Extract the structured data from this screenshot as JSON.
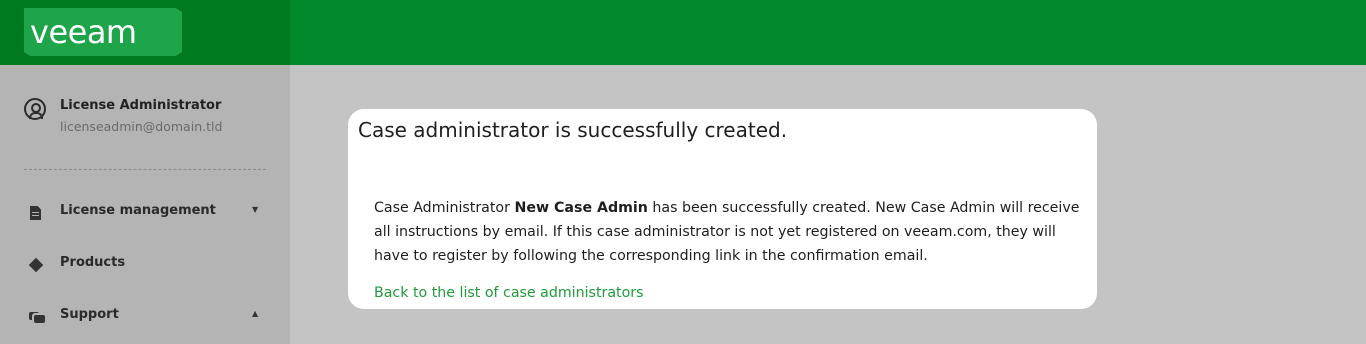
{
  "brand": {
    "logo_text": "veeam"
  },
  "user": {
    "name": "License Administrator",
    "email": "licenseadmin@domain.tld"
  },
  "nav": {
    "items": [
      {
        "label": "License management",
        "icon": "document-icon",
        "caret": "▼"
      },
      {
        "label": "Products",
        "icon": "box-icon"
      },
      {
        "label": "Support",
        "icon": "chat-icon",
        "caret": "▲"
      }
    ]
  },
  "dialog": {
    "title": "Case administrator is successfully created.",
    "body_prefix": "Case Administrator ",
    "body_bold": "New Case Admin",
    "body_suffix": " has been successfully created. New Case Admin will receive all instructions by email. If this case administrator is not yet registered on veeam.com, they will have to register by following the corresponding link in the confirmation email.",
    "back_link": "Back to the list of case administrators"
  },
  "colors": {
    "header_green": "#008a2c",
    "logo_green": "#00791f",
    "link_green": "#1f9a3a"
  }
}
